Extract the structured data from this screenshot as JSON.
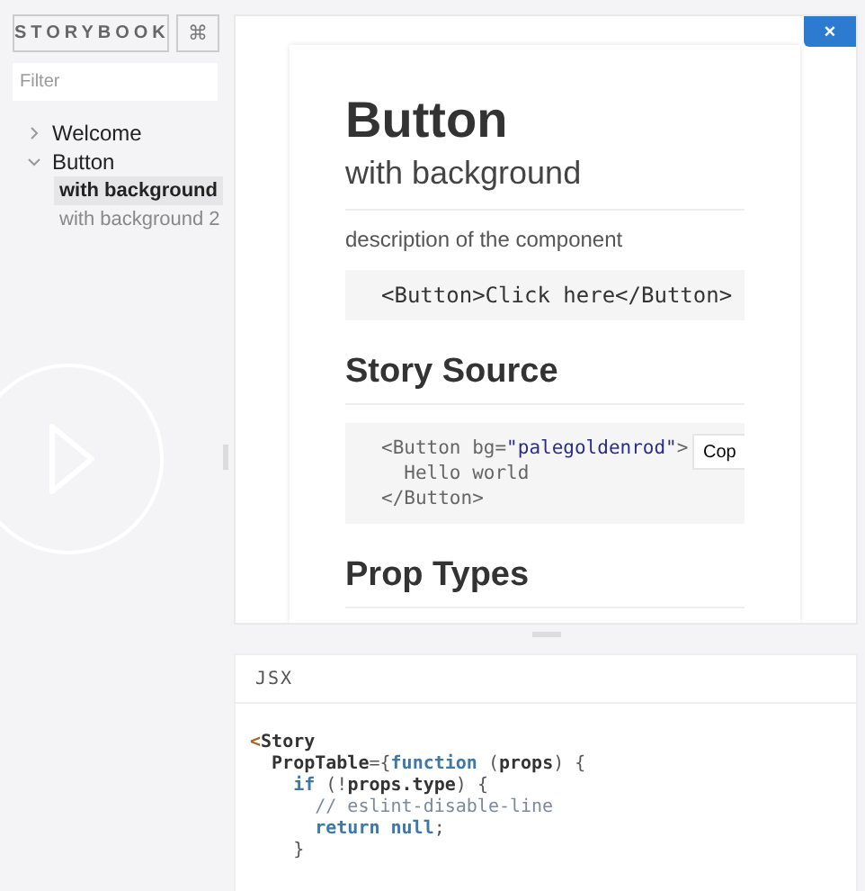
{
  "sidebar": {
    "brand": "STORYBOOK",
    "shortcut_button": "⌘",
    "filter": {
      "placeholder": "Filter"
    },
    "tree": [
      {
        "label": "Welcome",
        "expanded": false
      },
      {
        "label": "Button",
        "expanded": true,
        "children": [
          {
            "label": "with background",
            "selected": true
          },
          {
            "label": "with background 2",
            "selected": false
          }
        ]
      }
    ]
  },
  "preview": {
    "close_button": "×",
    "title": "Button",
    "subtitle": "with background",
    "description": "description of the component",
    "example_code": "<Button>Click here</Button>",
    "source_heading": "Story Source",
    "source_lines": [
      [
        {
          "kind": "plain",
          "text": "<Button bg="
        },
        {
          "kind": "string",
          "text": "\"palegoldenrod\""
        },
        {
          "kind": "plain",
          "text": ">"
        }
      ],
      [
        {
          "kind": "plain",
          "text": "  Hello world"
        }
      ],
      [
        {
          "kind": "plain",
          "text": "</Button>"
        }
      ]
    ],
    "copy_button": "Cop",
    "props_heading": "Prop Types"
  },
  "addon_panel": {
    "tabs": [
      {
        "label": "JSX",
        "selected": true
      }
    ],
    "code_lines": [
      [
        {
          "kind": "tag",
          "text": "<"
        },
        {
          "kind": "name",
          "text": "Story"
        }
      ],
      [
        {
          "kind": "name",
          "text": "  PropTable"
        },
        {
          "kind": "punct",
          "text": "={"
        },
        {
          "kind": "keyword",
          "text": "function"
        },
        {
          "kind": "punct",
          "text": " ("
        },
        {
          "kind": "name",
          "text": "props"
        },
        {
          "kind": "punct",
          "text": ") {"
        }
      ],
      [
        {
          "kind": "keyword",
          "text": "    if"
        },
        {
          "kind": "punct",
          "text": " (!"
        },
        {
          "kind": "name",
          "text": "props.type"
        },
        {
          "kind": "punct",
          "text": ") {"
        }
      ],
      [
        {
          "kind": "comment",
          "text": "      // eslint-disable-line"
        }
      ],
      [
        {
          "kind": "keyword",
          "text": "      return null"
        },
        {
          "kind": "punct",
          "text": ";"
        }
      ],
      [
        {
          "kind": "punct",
          "text": "    }"
        }
      ]
    ]
  }
}
